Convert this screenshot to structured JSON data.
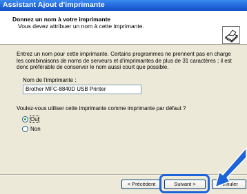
{
  "window": {
    "title": "Assistant Ajout d'imprimante"
  },
  "header": {
    "title": "Donnez un nom à votre imprimante",
    "subtitle": "Vous devez attribuer un nom à cette imprimante."
  },
  "body": {
    "description_lines": [
      "Entrez un nom pour cette imprimante. Certains programmes ne prennent pas en charge",
      "les combinaisons de noms de serveurs et d'imprimantes de plus de 31 caractères ; il est",
      "donc préférable de conserver le nom aussi court que possible."
    ],
    "printer_name_label": "Nom de l'imprimante :",
    "printer_name_value": "Brother MFC-8840D USB Printer",
    "default_question": "Voulez-vous utiliser cette imprimante comme imprimante par défaut ?",
    "options": [
      {
        "label": "Oui",
        "selected": true
      },
      {
        "label": "Non",
        "selected": false
      }
    ]
  },
  "buttons": {
    "back": "< Précédent",
    "next": "Suivant >",
    "cancel": "Annuler"
  },
  "colors": {
    "title_bar": "#1f63d8",
    "highlight": "#1d63d9",
    "arrow": "#1d63d9"
  },
  "icons": {
    "header_icon": "printer-icon"
  }
}
